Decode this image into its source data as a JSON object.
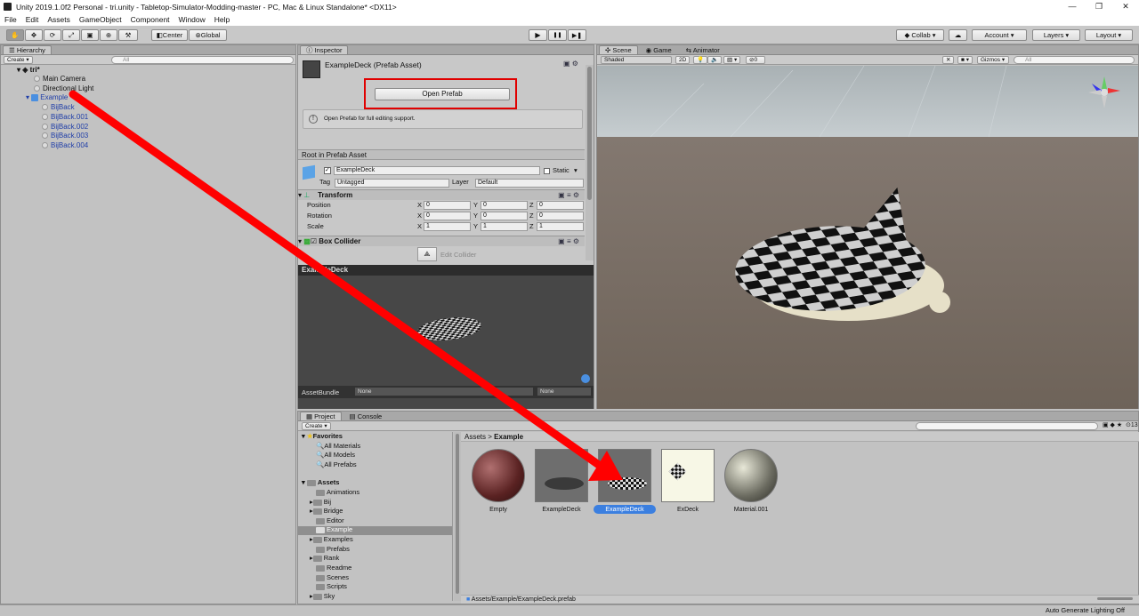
{
  "window": {
    "title": "Unity 2019.1.0f2 Personal - tri.unity - Tabletop-Simulator-Modding-master - PC, Mac & Linux Standalone* <DX11>",
    "minimize": "—",
    "maximize": "❐",
    "close": "✕"
  },
  "menu": [
    "File",
    "Edit",
    "Assets",
    "GameObject",
    "Component",
    "Window",
    "Help"
  ],
  "toolbar": {
    "center": "Center",
    "global": "Global",
    "collab": "Collab ▾",
    "account": "Account ▾",
    "layers": "Layers ▾",
    "layout": "Layout ▾",
    "play": "▶",
    "pause": "❚❚",
    "step": "▶❚"
  },
  "hierarchy": {
    "tab": "Hierarchy",
    "create": "Create ▾",
    "search": "All",
    "scene": "tri*",
    "items": [
      "Main Camera",
      "Directional Light",
      "Example",
      "BijBack",
      "BijBack.001",
      "BijBack.002",
      "BijBack.003",
      "BijBack.004"
    ]
  },
  "inspector": {
    "tab": "Inspector",
    "asset_name": "ExampleDeck (Prefab Asset)",
    "open_prefab": "Open Prefab",
    "info": "Open Prefab for full editing support.",
    "root_label": "Root in Prefab Asset",
    "object_name": "ExampleDeck",
    "static": "Static",
    "tag_label": "Tag",
    "tag_value": "Untagged",
    "layer_label": "Layer",
    "layer_value": "Default",
    "transform": {
      "title": "Transform",
      "rows": [
        {
          "label": "Position",
          "x": "0",
          "y": "0",
          "z": "0"
        },
        {
          "label": "Rotation",
          "x": "0",
          "y": "0",
          "z": "0"
        },
        {
          "label": "Scale",
          "x": "1",
          "y": "1",
          "z": "1"
        }
      ]
    },
    "box_collider": "Box Collider",
    "edit_collider": "Edit Collider",
    "preview_title": "ExampleDeck",
    "assetbundle": "AssetBundle",
    "ab_none1": "None",
    "ab_none2": "None",
    "axis_x": "X",
    "axis_y": "Y",
    "axis_z": "Z"
  },
  "scene": {
    "tabs": [
      "Scene",
      "Game",
      "Animator"
    ],
    "shaded": "Shaded",
    "mode2d": "2D",
    "gizmos": "Gizmos ▾",
    "search": "All",
    "zero": "0",
    "persp": "< Persp"
  },
  "project": {
    "tabs": [
      "Project",
      "Console"
    ],
    "create": "Create ▾",
    "favorites": "Favorites",
    "fav_items": [
      "All Materials",
      "All Models",
      "All Prefabs"
    ],
    "assets": "Assets",
    "folders": [
      "Animations",
      "Bij",
      "Bridge",
      "Editor",
      "Example",
      "Examples",
      "Prefabs",
      "Rank",
      "Readme",
      "Scenes",
      "Scripts",
      "Sky"
    ],
    "breadcrumb": "Assets",
    "breadcrumb_sep": ">",
    "breadcrumb_current": "Example",
    "thumbs": [
      "Empty",
      "ExampleDeck",
      "ExampleDeck",
      "ExDeck",
      "Material.001"
    ],
    "path": "Assets/Example/ExampleDeck.prefab",
    "count": "13"
  },
  "status": "Auto Generate Lighting Off",
  "colors": {
    "accent": "#3b7fe0",
    "annotation_red": "#ff0000",
    "scene_floor": "#7a6e63"
  }
}
